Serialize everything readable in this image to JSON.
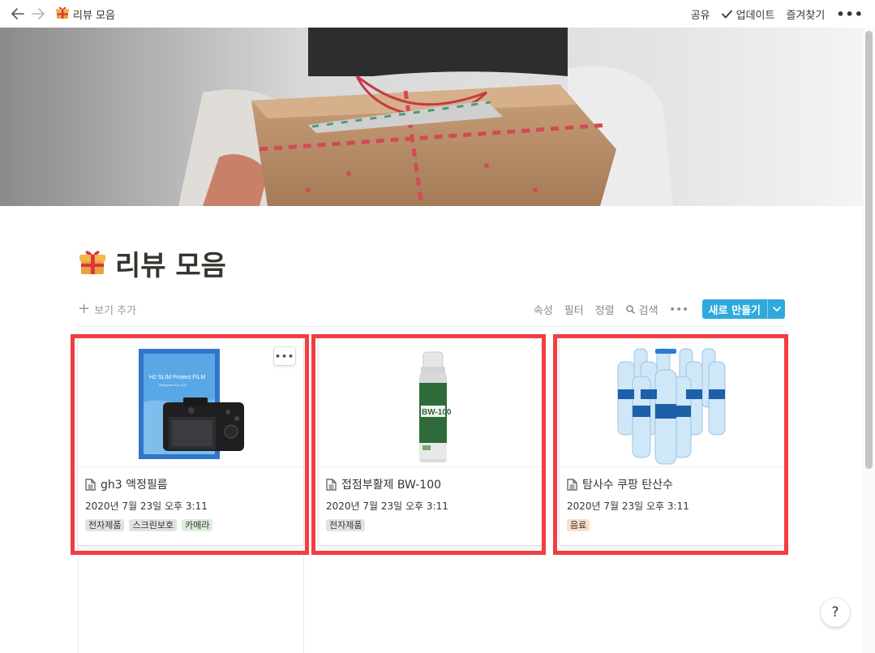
{
  "topbar": {
    "back_icon": "arrow-left-icon",
    "forward_icon": "arrow-right-icon",
    "page_icon": "gift-icon",
    "breadcrumb": "리뷰 모음",
    "share": "공유",
    "updates": "업데이트",
    "favorite": "즐겨찾기",
    "more_icon": "more-horizontal-icon"
  },
  "page": {
    "icon": "gift-icon",
    "title": "리뷰 모음"
  },
  "toolbar": {
    "add_view": "보기 추가",
    "properties": "속성",
    "filter": "필터",
    "sort": "정렬",
    "search": "검색",
    "new_button": "새로 만들기"
  },
  "cards": [
    {
      "title": "gh3 액정필름",
      "date": "2020년 7월 23일 오후 3:11",
      "image": "screen-protector-camera",
      "tags": [
        {
          "label": "전자제품",
          "color": "#e3e2e0"
        },
        {
          "label": "스크린보호",
          "color": "#e3e2e0"
        },
        {
          "label": "카메라",
          "color": "#dbeddb"
        }
      ]
    },
    {
      "title": "접점부활제 BW-100",
      "date": "2020년 7월 23일 오후 3:11",
      "image": "spray-can",
      "tags": [
        {
          "label": "전자제품",
          "color": "#e3e2e0"
        }
      ]
    },
    {
      "title": "탐사수 쿠팡 탄산수",
      "date": "2020년 7월 23일 오후 3:11",
      "image": "water-bottles",
      "tags": [
        {
          "label": "음료",
          "color": "#fadec9"
        }
      ]
    }
  ],
  "product_labels": {
    "film_box_line1": "H2 SLIM Protect FILM",
    "film_box_line2": "Safeguard For LCD",
    "spray_label": "BW-100"
  },
  "help": "?",
  "colors": {
    "accent": "#2eaadc",
    "highlight": "#f23d41",
    "text": "#37352f",
    "muted": "#9b9a97"
  }
}
